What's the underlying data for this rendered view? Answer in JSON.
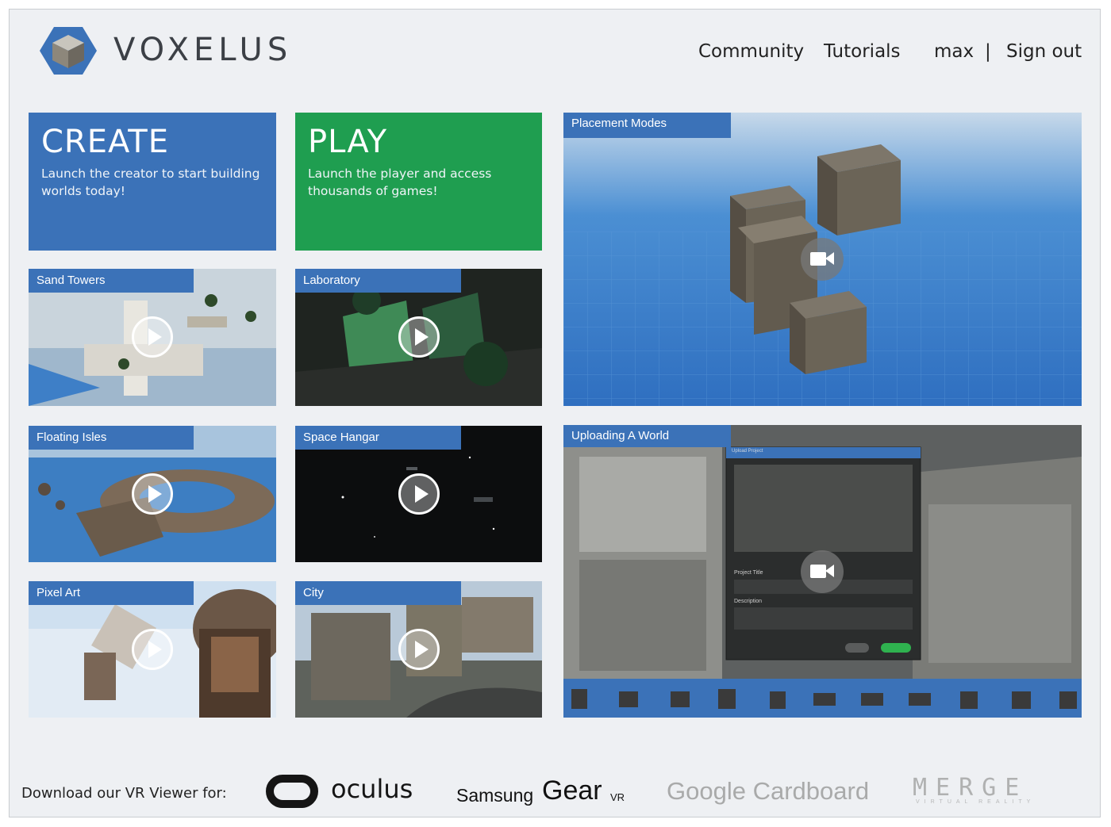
{
  "header": {
    "logo_text": "VOXELUS",
    "nav": {
      "community": "Community",
      "tutorials": "Tutorials",
      "user": "max",
      "separator": "|",
      "signout": "Sign out"
    }
  },
  "create": {
    "title": "CREATE",
    "desc": "Launch the creator to start building worlds today!"
  },
  "play": {
    "title": "PLAY",
    "desc": "Launch the player and access thousands of games!"
  },
  "videos": {
    "sand_towers": "Sand Towers",
    "laboratory": "Laboratory",
    "floating_isles": "Floating Isles",
    "space_hangar": "Space Hangar",
    "pixel_art": "Pixel Art",
    "city": "City"
  },
  "features": {
    "placement_modes": "Placement Modes",
    "uploading": "Uploading A World",
    "upload_dialog": {
      "header": "Upload Project",
      "project_title": "Project Title",
      "description": "Description"
    }
  },
  "footer": {
    "label": "Download our VR Viewer for:",
    "oculus": "oculus",
    "samsung": "Samsung",
    "gear": "Gear",
    "vr": "VR",
    "cardboard": "Google Cardboard",
    "merge": "MERGE",
    "merge_sub": "VIRTUAL REALITY"
  },
  "colors": {
    "blue": "#3b72b8",
    "green": "#1f9e50",
    "background": "#eef0f3"
  },
  "icons": [
    "play-icon",
    "video-camera-icon",
    "voxelus-cube-logo",
    "oculus-ring-icon"
  ]
}
